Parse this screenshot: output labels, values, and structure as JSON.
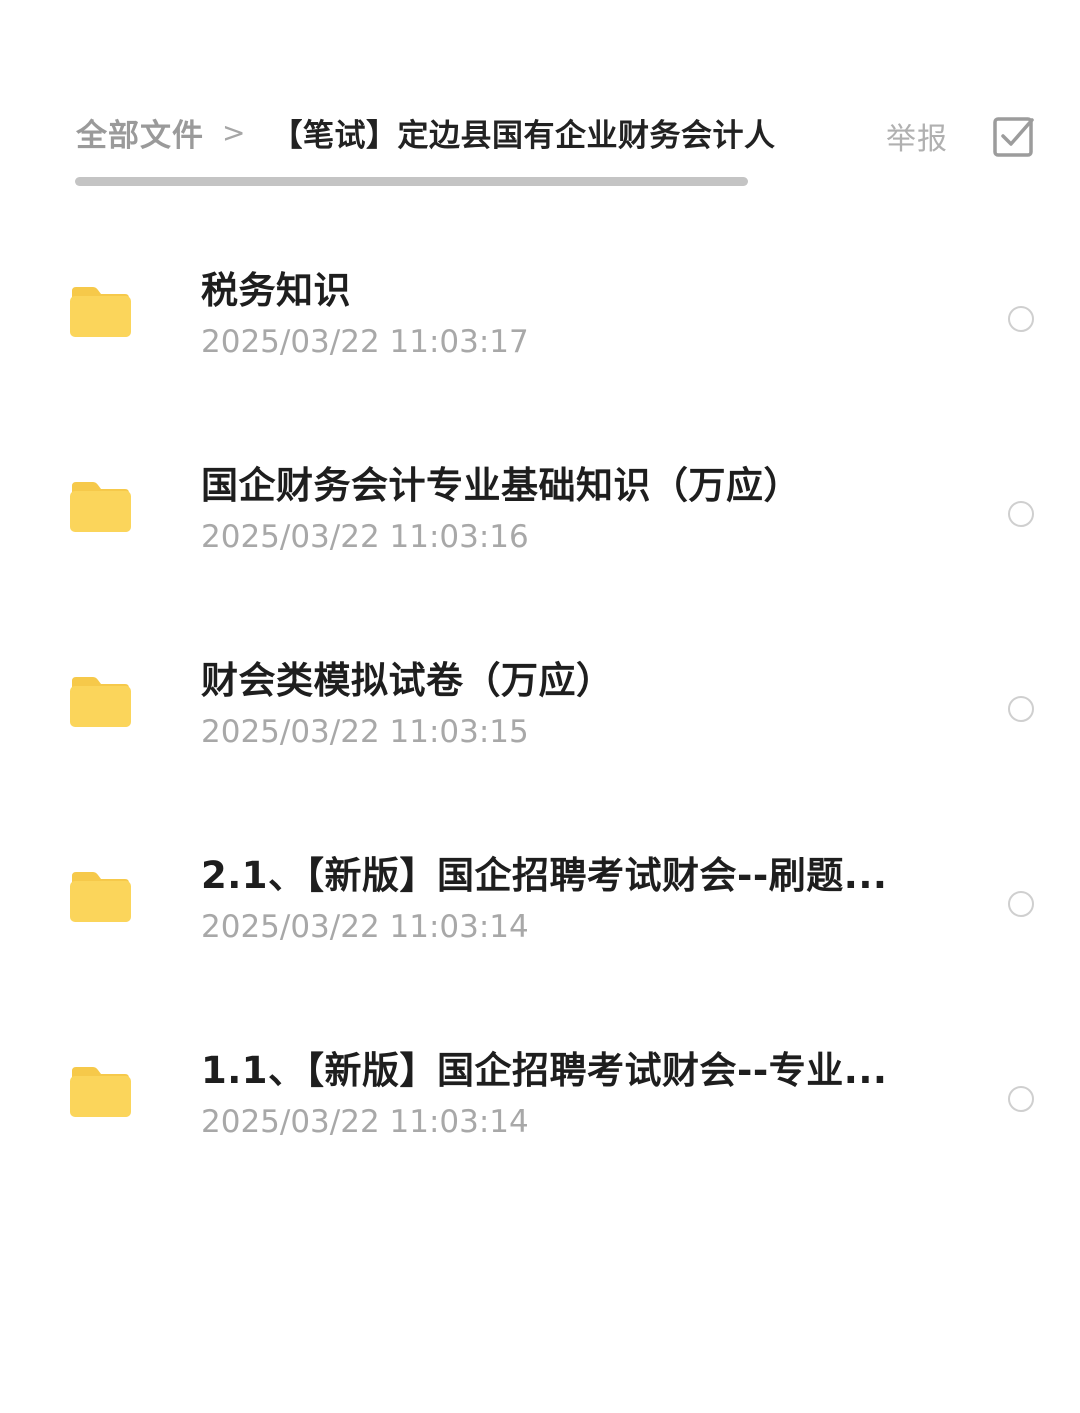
{
  "breadcrumb": {
    "root": "全部文件",
    "separator": ">",
    "current": "【笔试】定边县国有企业财务会计人"
  },
  "header": {
    "report_label": "举报",
    "select_icon": "checkbox-select-icon"
  },
  "colors": {
    "folder": "#fbd55b",
    "folder_tab": "#f6c94a",
    "text_primary": "#1e1e1e",
    "text_secondary": "#a8a8a8"
  },
  "files": [
    {
      "name": "税务知识",
      "time": "2025/03/22 11:03:17",
      "icon": "folder-icon"
    },
    {
      "name": "国企财务会计专业基础知识（万应）",
      "time": "2025/03/22 11:03:16",
      "icon": "folder-icon"
    },
    {
      "name": "财会类模拟试卷（万应）",
      "time": "2025/03/22 11:03:15",
      "icon": "folder-icon"
    },
    {
      "name": "2.1、【新版】国企招聘考试财会--刷题...",
      "time": "2025/03/22 11:03:14",
      "icon": "folder-icon"
    },
    {
      "name": "1.1、【新版】国企招聘考试财会--专业...",
      "time": "2025/03/22 11:03:14",
      "icon": "folder-icon"
    }
  ]
}
